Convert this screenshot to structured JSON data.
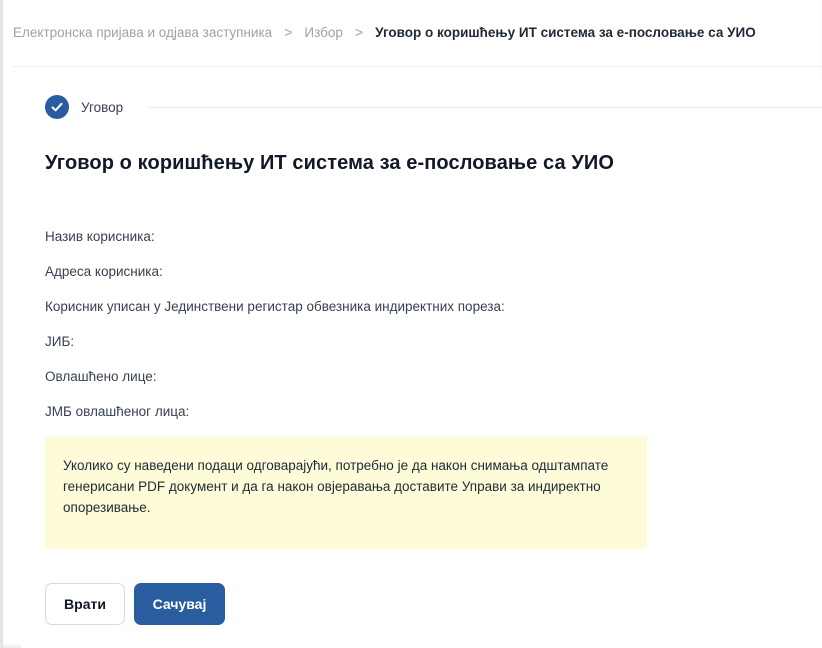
{
  "breadcrumb": {
    "items": [
      "Електронска пријава и одјава заступника",
      "Избор",
      "Уговор о коришћењу ИТ система за е-пословање са УИО"
    ],
    "separator": ">"
  },
  "stepper": {
    "step_label": "Уговор",
    "step_icon": "check-icon",
    "step_color": "#2a5d9f"
  },
  "form": {
    "title": "Уговор о коришћењу ИТ система за е-пословање са УИО",
    "fields": [
      "Назив корисника:",
      "Адреса корисника:",
      "Корисник уписан у Јединствени регистар обвезника индиректних пореза:",
      "ЈИБ:",
      "Овлашћено лице:",
      "ЈМБ овлашћеног лица:"
    ],
    "notice": "Уколико су наведени подаци одговарајући, потребно је да након снимања одштампате генерисани PDF документ и да га након овјеравања доставите Управи за индиректно опорезивање.",
    "notice_bg": "#fdfbd8"
  },
  "actions": {
    "back_label": "Врати",
    "save_label": "Сачувај",
    "primary_color": "#2a5d9f"
  }
}
